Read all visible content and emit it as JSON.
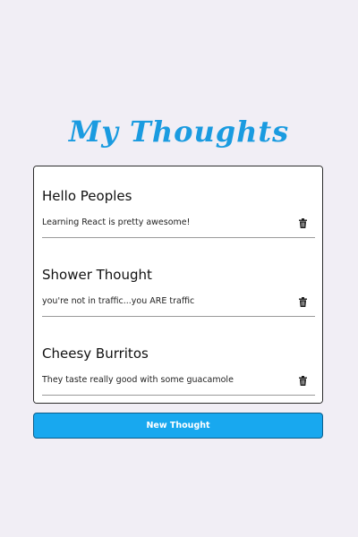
{
  "header": {
    "title": "My Thoughts"
  },
  "thoughts": [
    {
      "title": "Hello Peoples",
      "body": "Learning React is pretty awesome!",
      "delete_icon": "trash-icon"
    },
    {
      "title": "Shower Thought",
      "body": "you're not in traffic...you ARE traffic",
      "delete_icon": "trash-icon"
    },
    {
      "title": "Cheesy Burritos",
      "body": "They taste really good with some guacamole",
      "delete_icon": "trash-icon"
    }
  ],
  "actions": {
    "new_thought_label": "New Thought"
  },
  "colors": {
    "accent": "#18a8ef",
    "title": "#1a9be0",
    "background": "#f1eef5"
  }
}
